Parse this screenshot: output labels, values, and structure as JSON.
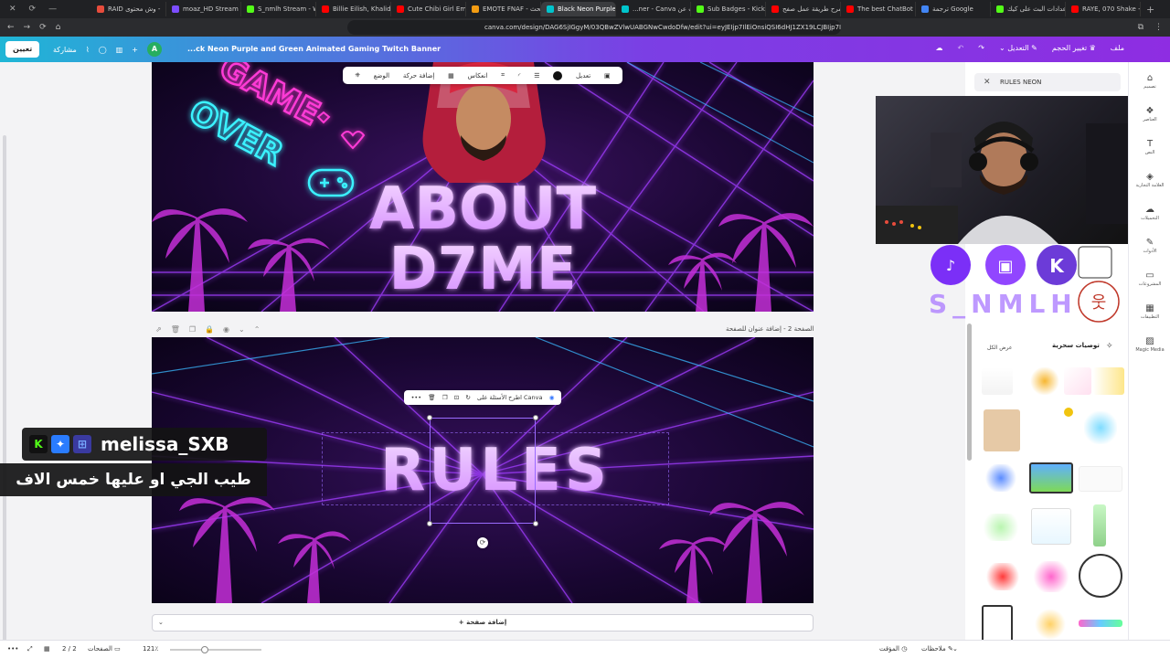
{
  "browser": {
    "tabs": [
      {
        "label": "RAID وش محتوى -",
        "color": "#e74c3c"
      },
      {
        "label": "moaz_HD Stream - W",
        "color": "#7c4dff"
      },
      {
        "label": "S_nmlh Stream - Wat",
        "color": "#53fc18"
      },
      {
        "label": "Billie Eilish, Khalid -",
        "color": "#ff0000"
      },
      {
        "label": "Cute Chibi Girl Emot",
        "color": "#ff0000"
      },
      {
        "label": "EMOTE FNAF - بحث",
        "color": "#f39c12"
      },
      {
        "label": "Black Neon Purple",
        "color": "#00c4cc",
        "active": true
      },
      {
        "label": "...ner - Canva بحث عن",
        "color": "#00c4cc"
      },
      {
        "label": "Sub Badges - Kick Dis",
        "color": "#53fc18"
      },
      {
        "label": "شرح طريقة عمل صفح",
        "color": "#ff0000"
      },
      {
        "label": "The best ChatBot and",
        "color": "#ff0000"
      },
      {
        "label": "ترجمة Google",
        "color": "#4285f4"
      },
      {
        "label": "إعدادات البث على كيك",
        "color": "#53fc18"
      },
      {
        "label": "RAYE, 070 Shake - Esc",
        "color": "#ff0000"
      }
    ],
    "url": "canva.com/design/DAG6SjIGgyM/03QBwZVlwUABGNwCwdoDfw/edit?ui=eyJEIjp7IlEiOnsiQSI6dHJ1ZX19LCJBIjp7IkX0"
  },
  "header": {
    "share_label": "تعيين",
    "share2_label": "مشاركة",
    "avatar_letter": "A",
    "doc_title": "...ck Neon Purple and Green Animated Gaming Twitch Banner",
    "edit_label": "التعديل",
    "resize_label": "تغيير الحجم",
    "file_label": "ملف"
  },
  "toolbar": {
    "items": [
      "الوضع",
      "إضافة حركة",
      "انعكاس",
      "تعديل"
    ]
  },
  "page1": {
    "line1": "ABOUT",
    "line2": "D7ME",
    "neon_game": "GAME",
    "neon_over": "OVER"
  },
  "page2": {
    "label": "الصفحة 2 - إضافة عنوان للصفحة",
    "text": "RULES",
    "ctx_label": "اطرح الأسئلة على Canva"
  },
  "add_page_label": "+ إضافة صفحة",
  "chat": {
    "username": "melissa_SXB",
    "message": "طيب الجي او عليها خمس الاف"
  },
  "rpanel": {
    "search_value": "RULES NEON",
    "stream_name": "S_NMLH",
    "magic_title": "توصيات سحرية",
    "magic_all": "عرض الكل"
  },
  "iconrail": [
    {
      "label": "تصميم",
      "icon": "design-icon"
    },
    {
      "label": "العناصر",
      "icon": "elements-icon"
    },
    {
      "label": "النص",
      "icon": "text-icon"
    },
    {
      "label": "العلامة التجارية",
      "icon": "brand-icon"
    },
    {
      "label": "التحميلات",
      "icon": "upload-icon"
    },
    {
      "label": "الأدوات",
      "icon": "tools-icon"
    },
    {
      "label": "المشروعات",
      "icon": "projects-icon"
    },
    {
      "label": "التطبيقات",
      "icon": "apps-icon"
    },
    {
      "label": "Magic Media",
      "icon": "magic-media-icon"
    }
  ],
  "bottombar": {
    "notes": "ملاحظات",
    "timer": "المؤقت",
    "pages": "الصفحات",
    "page_count": "2 / 2",
    "zoom": "121٪"
  },
  "colors": {
    "neon_pink": "#ff3ad6",
    "neon_cyan": "#3af2ff",
    "grid_purple": "#b03cff",
    "header_start": "#1fb6d6",
    "header_end": "#8e2de2"
  }
}
